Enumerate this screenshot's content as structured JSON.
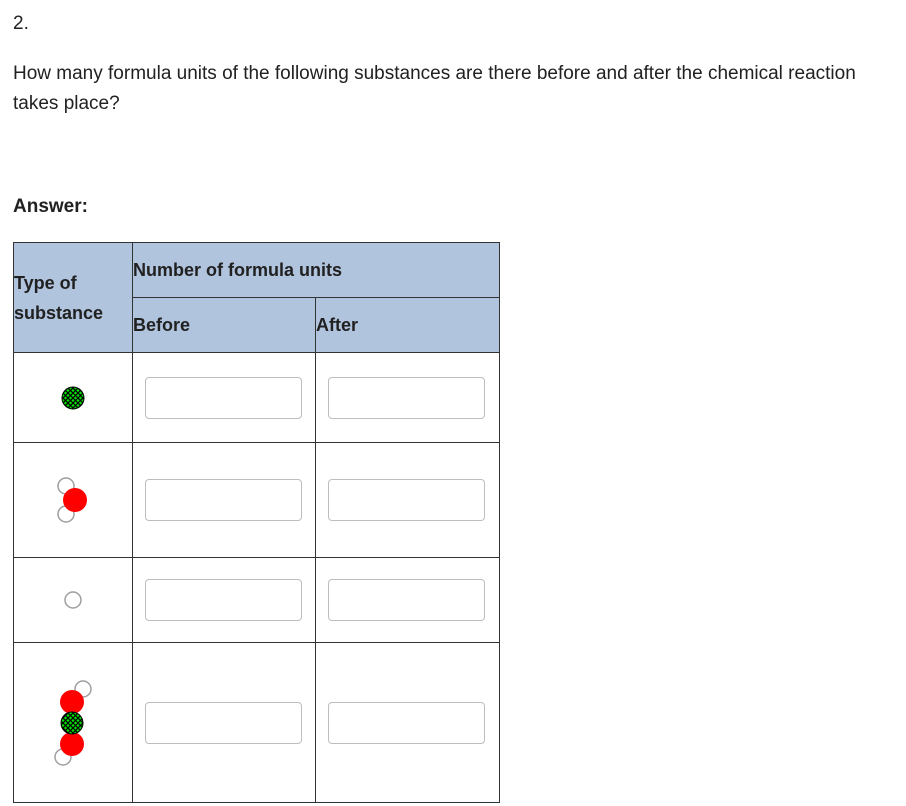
{
  "question": {
    "number": "2.",
    "text": "How many formula units of the following substances are there before and after the chemical reaction takes place?"
  },
  "answer_label": "Answer:",
  "table": {
    "type_header": "Type of substance",
    "group_header": "Number of formula units",
    "before_header": "Before",
    "after_header": "After",
    "rows": [
      {
        "substance_icon": "green-atom-icon",
        "before": "",
        "after": ""
      },
      {
        "substance_icon": "water-molecule-icon",
        "before": "",
        "after": ""
      },
      {
        "substance_icon": "white-atom-icon",
        "before": "",
        "after": ""
      },
      {
        "substance_icon": "h-o-x-o-h-molecule-icon",
        "before": "",
        "after": ""
      }
    ]
  },
  "colors": {
    "header_bg": "#b0c4de",
    "red_atom": "#ff0000",
    "green_atom": "#00e000",
    "white_atom": "#ffffff"
  }
}
